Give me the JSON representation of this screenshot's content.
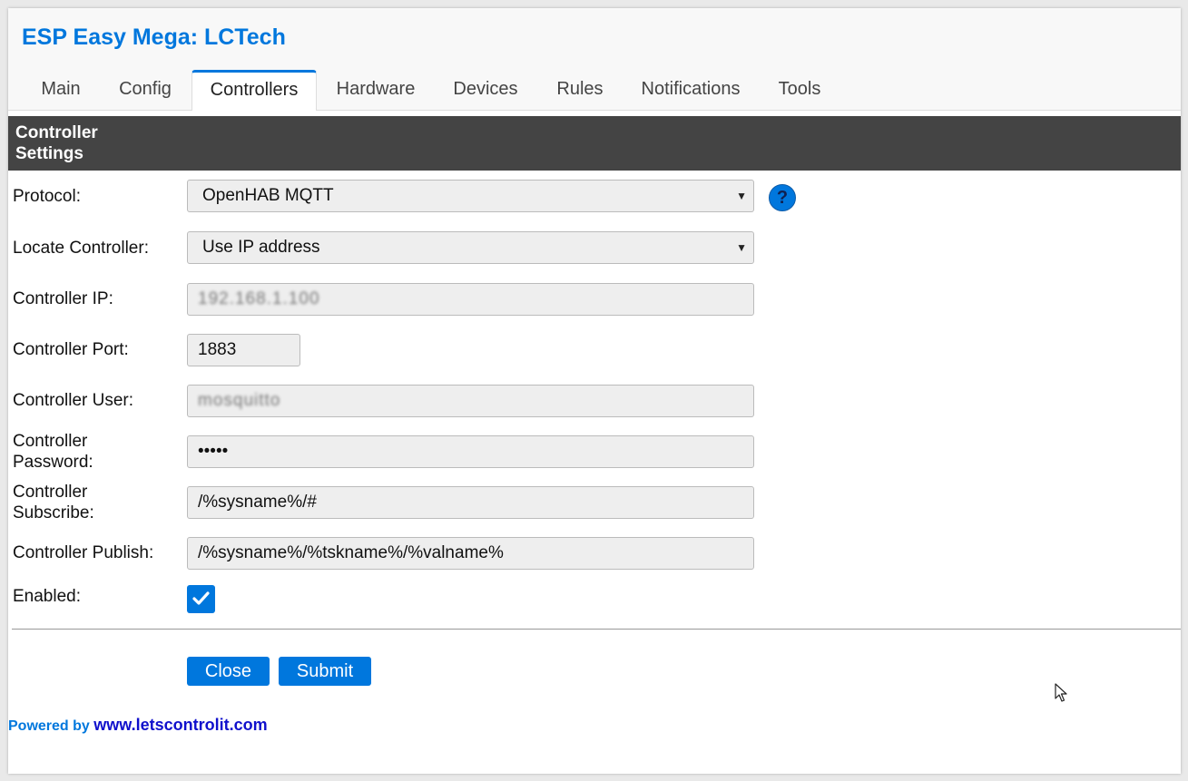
{
  "app": {
    "title": "ESP Easy Mega: LCTech"
  },
  "nav": {
    "tabs": [
      {
        "label": "Main"
      },
      {
        "label": "Config"
      },
      {
        "label": "Controllers",
        "active": true
      },
      {
        "label": "Hardware"
      },
      {
        "label": "Devices"
      },
      {
        "label": "Rules"
      },
      {
        "label": "Notifications"
      },
      {
        "label": "Tools"
      }
    ]
  },
  "section": {
    "title_line1": "Controller",
    "title_line2": "Settings"
  },
  "form": {
    "protocol": {
      "label": "Protocol:",
      "value": "OpenHAB MQTT",
      "help_glyph": "?"
    },
    "locate": {
      "label": "Locate Controller:",
      "value": "Use IP address"
    },
    "ip": {
      "label": "Controller IP:",
      "value": "192.168.1.100"
    },
    "port": {
      "label": "Controller Port:",
      "value": "1883"
    },
    "user": {
      "label": "Controller User:",
      "value": "mosquitto"
    },
    "password": {
      "label_line1": "Controller",
      "label_line2": "Password:",
      "value": "•••••"
    },
    "subscribe": {
      "label_line1": "Controller",
      "label_line2": "Subscribe:",
      "value": "/%sysname%/#"
    },
    "publish": {
      "label": "Controller Publish:",
      "value": "/%sysname%/%tskname%/%valname%"
    },
    "enabled": {
      "label": "Enabled:",
      "checked": true
    }
  },
  "buttons": {
    "close": "Close",
    "submit": "Submit"
  },
  "footer": {
    "powered_by": "Powered by",
    "link": "www.letscontrolit.com"
  },
  "colors": {
    "accent": "#0077dd",
    "header_bg": "#444444",
    "field_bg": "#eeeeee"
  }
}
